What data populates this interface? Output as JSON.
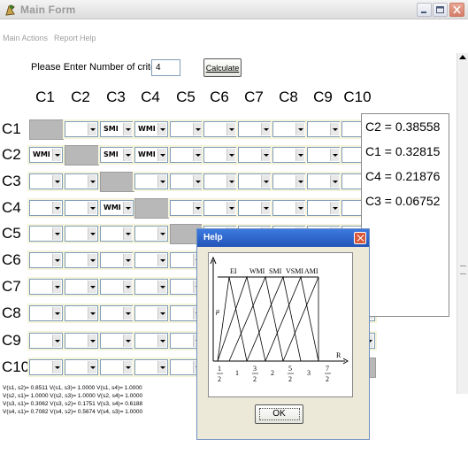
{
  "window": {
    "title": "Main Form",
    "menu": [
      "Main Actions",
      "Report",
      "Help"
    ]
  },
  "form": {
    "criteria_label": "Please Enter Number of criteria:",
    "criteria_value": "4",
    "calculate_label": "Calculate"
  },
  "matrix": {
    "column_headers": [
      "C1",
      "C2",
      "C3",
      "C4",
      "C5",
      "C6",
      "C7",
      "C8",
      "C9",
      "C10"
    ],
    "row_headers": [
      "C1",
      "C2",
      "C3",
      "C4",
      "C5",
      "C6",
      "C7",
      "C8",
      "C9",
      "C10"
    ],
    "values": [
      [
        "",
        "",
        "SMI",
        "WMI",
        "",
        "",
        "",
        "",
        "",
        ""
      ],
      [
        "WMI",
        "",
        "SMI",
        "WMI",
        "",
        "",
        "",
        "",
        "",
        ""
      ],
      [
        "",
        "",
        "",
        "",
        "",
        "",
        "",
        "",
        "",
        ""
      ],
      [
        "",
        "",
        "WMI",
        "",
        "",
        "",
        "",
        "",
        "",
        ""
      ],
      [
        "",
        "",
        "",
        "",
        "",
        "",
        "",
        "",
        "",
        ""
      ],
      [
        "",
        "",
        "",
        "",
        "",
        "",
        "",
        "",
        "",
        ""
      ],
      [
        "",
        "",
        "",
        "",
        "",
        "",
        "",
        "",
        "",
        ""
      ],
      [
        "",
        "",
        "",
        "",
        "",
        "",
        "",
        "",
        "",
        ""
      ],
      [
        "",
        "",
        "",
        "",
        "",
        "",
        "",
        "",
        "",
        ""
      ],
      [
        "",
        "",
        "",
        "",
        "",
        "",
        "",
        "",
        "",
        ""
      ]
    ]
  },
  "results": [
    "C2 = 0.38558",
    "C1 = 0.32815",
    "C4 = 0.21876",
    "C3 = 0.06752"
  ],
  "log": [
    "V(s1, s2)= 0.8511 V(s1, s3)= 1.0000 V(s1, s4)= 1.0000",
    "V(s2, s1)= 1.0000 V(s2, s3)= 1.0000 V(s2, s4)= 1.0000",
    "V(s3, s1)= 0.3062 V(s3, s2)= 0.1751 V(s3, s4)= 0.6188",
    "V(s4, s1)= 0.7082 V(s4, s2)= 0.5674 V(s4, s3)= 1.0000"
  ],
  "help": {
    "title": "Help",
    "ok_label": "OK",
    "scale_labels": [
      "EI",
      "WMI",
      "SMI",
      "VSMI",
      "AMI"
    ],
    "axis_label": "R",
    "y_label": "μ",
    "x_ticks": [
      {
        "num": "1",
        "den": "2"
      },
      {
        "num": "1",
        "den": ""
      },
      {
        "num": "3",
        "den": "2"
      },
      {
        "num": "2",
        "den": ""
      },
      {
        "num": "5",
        "den": "2"
      },
      {
        "num": "3",
        "den": ""
      },
      {
        "num": "7",
        "den": "2"
      }
    ]
  },
  "colors": {
    "help_title_bar": "#2454b8",
    "diagonal_cell": "#b8b8b8",
    "cell_halo": "#f5f3da"
  }
}
